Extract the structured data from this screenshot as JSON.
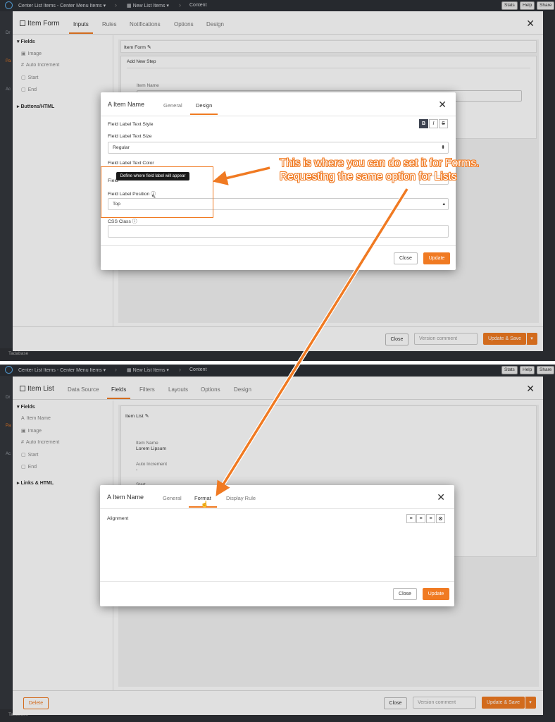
{
  "top": {
    "breadcrumb1": "Center List Items - Center Menu Items",
    "breadcrumb2": "New List Items",
    "breadcrumb3": "Content",
    "stats": "Stats",
    "help": "Help",
    "share": "Share",
    "back_label": "Tadabase"
  },
  "form_panel": {
    "title": "Item Form",
    "tabs": [
      "Inputs",
      "Rules",
      "Notifications",
      "Options",
      "Design"
    ],
    "sidebar": {
      "group1": "Fields",
      "items": [
        "Image",
        "Auto Increment",
        "Start",
        "End"
      ],
      "group2": "Buttons/HTML"
    },
    "card_title": "Item Form",
    "step_label": "Add New Step",
    "field_label": "Item Name",
    "footer": {
      "close": "Close",
      "comment_placeholder": "Version comment",
      "update_save": "Update & Save"
    }
  },
  "form_modal": {
    "title": "Item Name",
    "tabs": [
      "General",
      "Design"
    ],
    "text_style_label": "Field Label Text Style",
    "style_buttons": [
      "B",
      "I",
      "S"
    ],
    "text_size_label": "Field Label Text Size",
    "text_size_value": "Regular",
    "text_color_label": "Field Label Text Color",
    "label_position_label": "Field Label Position",
    "tooltip": "Define where field label will appear",
    "label_position_value": "Top",
    "css_class_label": "CSS Class",
    "close": "Close",
    "update": "Update"
  },
  "annotation": {
    "line1": "This is where you can do set it for Forms.",
    "line2": "Requesting the same option for Lists"
  },
  "list_panel": {
    "title": "Item List",
    "tabs": [
      "Data Source",
      "Fields",
      "Filters",
      "Layouts",
      "Options",
      "Design"
    ],
    "sidebar": {
      "group1": "Fields",
      "items": [
        "Item Name",
        "Image",
        "Auto Increment",
        "Start",
        "End"
      ],
      "group2": "Links & HTML"
    },
    "card_title": "Item List",
    "preview": [
      {
        "label": "Item Name",
        "value": "Lorem Lipsum"
      },
      {
        "label": "Auto Increment",
        "value": "-"
      },
      {
        "label": "Start",
        "value": ""
      }
    ],
    "footer": {
      "delete": "Delete",
      "close": "Close",
      "comment_placeholder": "Version comment",
      "update_save": "Update & Save"
    }
  },
  "list_modal": {
    "title": "Item Name",
    "tabs": [
      "General",
      "Format",
      "Display Rule"
    ],
    "alignment_label": "Alignment",
    "close": "Close",
    "update": "Update"
  },
  "colors": {
    "accent": "#f07a22",
    "topbar": "#2c2f35"
  }
}
